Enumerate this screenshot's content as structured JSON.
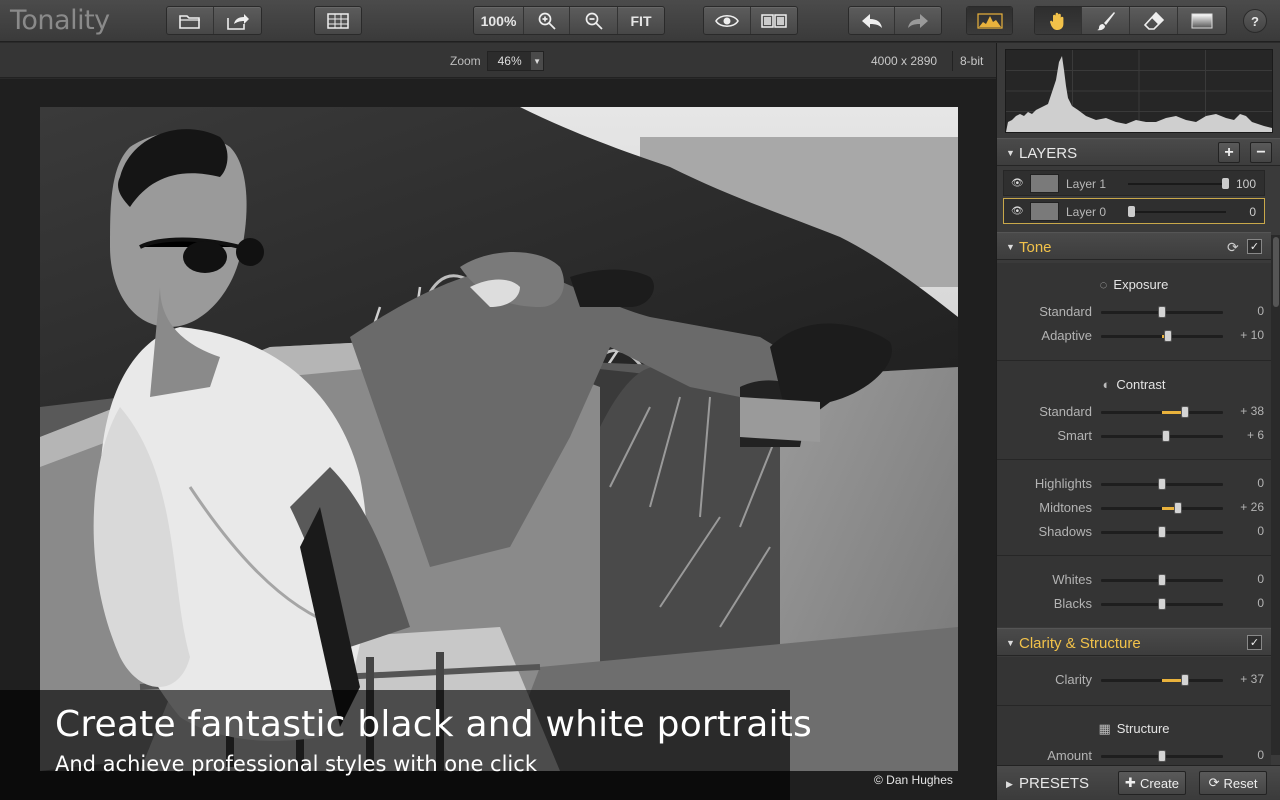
{
  "app": {
    "title": "Tonality"
  },
  "toolbar": {
    "zoom100_label": "100%",
    "fit_label": "FIT",
    "help_label": "?"
  },
  "zoombar": {
    "zoom_label": "Zoom",
    "zoom_value": "46%",
    "dimensions": "4000 x 2890",
    "bit_depth": "8-bit"
  },
  "photo": {
    "caption_title": "Create fantastic black and white portraits",
    "caption_subtitle": "And achieve professional styles with one click",
    "credit": "© Dan Hughes"
  },
  "layers": {
    "title": "LAYERS",
    "add_label": "+",
    "remove_label": "−",
    "items": [
      {
        "name": "Layer 1",
        "opacity": 100,
        "value_label": "100"
      },
      {
        "name": "Layer 0",
        "opacity": 0,
        "value_label": "0"
      }
    ]
  },
  "tone": {
    "title": "Tone",
    "exposure": {
      "title": "Exposure",
      "standard": {
        "label": "Standard",
        "value": 0,
        "display": "0"
      },
      "adaptive": {
        "label": "Adaptive",
        "value": 10,
        "display": "+ 10"
      }
    },
    "contrast": {
      "title": "Contrast",
      "standard": {
        "label": "Standard",
        "value": 38,
        "display": "+ 38"
      },
      "smart": {
        "label": "Smart",
        "value": 6,
        "display": "+ 6"
      }
    },
    "tonal": {
      "highlights": {
        "label": "Highlights",
        "value": 0,
        "display": "0"
      },
      "midtones": {
        "label": "Midtones",
        "value": 26,
        "display": "+ 26"
      },
      "shadows": {
        "label": "Shadows",
        "value": 0,
        "display": "0"
      }
    },
    "levels": {
      "whites": {
        "label": "Whites",
        "value": 0,
        "display": "0"
      },
      "blacks": {
        "label": "Blacks",
        "value": 0,
        "display": "0"
      }
    }
  },
  "clarity": {
    "title": "Clarity & Structure",
    "clarity": {
      "label": "Clarity",
      "value": 37,
      "display": "+ 37"
    },
    "structure_title": "Structure",
    "amount": {
      "label": "Amount",
      "value": 0,
      "display": "0"
    }
  },
  "presets": {
    "title": "PRESETS",
    "create_label": "Create",
    "reset_label": "Reset"
  },
  "colors": {
    "accent": "#e9b23c",
    "heading_gold": "#f2c24a"
  }
}
